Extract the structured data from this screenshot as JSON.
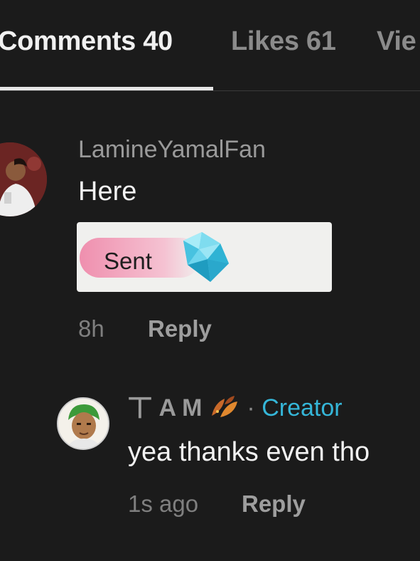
{
  "tabs": [
    {
      "label": "Comments 40",
      "active": true
    },
    {
      "label": "Likes 61",
      "active": false
    },
    {
      "label": "Vie",
      "active": false
    }
  ],
  "comments": [
    {
      "username": "LamineYamalFan",
      "text": "Here",
      "gift": {
        "label": "Sent",
        "icon": "diamond-icon"
      },
      "time": "8h",
      "reply_label": "Reply",
      "replies": [
        {
          "username": "丅 A M",
          "badge_icon": "autumn-leaves-icon",
          "separator": "·",
          "role": "Creator",
          "text": "yea thanks even tho",
          "time": "1s ago",
          "reply_label": "Reply"
        }
      ]
    }
  ],
  "colors": {
    "background": "#1b1b1b",
    "creator_accent": "#35b6d8",
    "gift_pill": "#ef8fae"
  }
}
